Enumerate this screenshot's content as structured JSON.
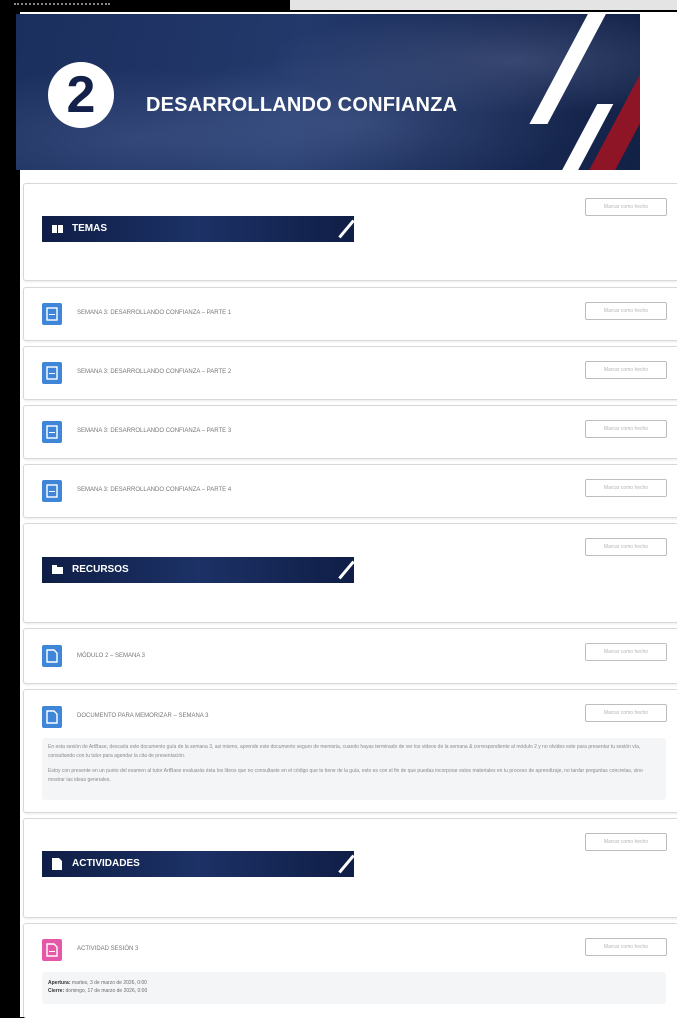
{
  "hero": {
    "number": "2",
    "title": "DESARROLLANDO CONFIANZA"
  },
  "mark_label": "Marcar como hecho",
  "sections": {
    "temas": "TEMAS",
    "recursos": "RECURSOS",
    "actividades": "ACTIVIDADES"
  },
  "temas_items": [
    "SEMANA 3: DESARROLLANDO CONFIANZA – PARTE 1",
    "SEMANA 3: DESARROLLANDO CONFIANZA – PARTE 2",
    "SEMANA 3: DESARROLLANDO CONFIANZA – PARTE 3",
    "SEMANA 3: DESARROLLANDO CONFIANZA – PARTE 4"
  ],
  "recursos_items": [
    "MÓDULO 2 – SEMANA 3",
    "DOCUMENTO PARA MEMORIZAR – SEMANA 3"
  ],
  "doc_desc": {
    "p1": "En esta sesión de ArtBase, descarla este documento guía de la semana 3, asi mismo, aprende este documento seguro de memoria, cuando hayas terminado de ver los videos de la semana & correspondiente al módulo 2 y no olvides este para presentar tu sesión vía, consultando con tu tutor para agendar la cita de presentación.",
    "p2": "Estoy con presente en un punto del examen al tutor ArtBase evaluarás ésta los libros que no consultaste en el código que te tiene de la guía, esto es con el fin de que puedas incorporar estos materiales en tu proceso de aprendizaje, no tardar preguntas concretas, sino mostrar las ideas generales."
  },
  "actividad": {
    "title": "ACTIVIDAD SESIÓN 3",
    "apertura_label": "Apertura:",
    "apertura_value": "martes, 3 de marzo de 2026, 0:00",
    "cierre_label": "Cierre:",
    "cierre_value": "domingo, 17 de marzo de 2026, 0:00"
  },
  "colors": {
    "accent_blue": "#3f86d8",
    "navy": "#13214a",
    "red": "#8d1526",
    "pink": "#e558a8"
  }
}
